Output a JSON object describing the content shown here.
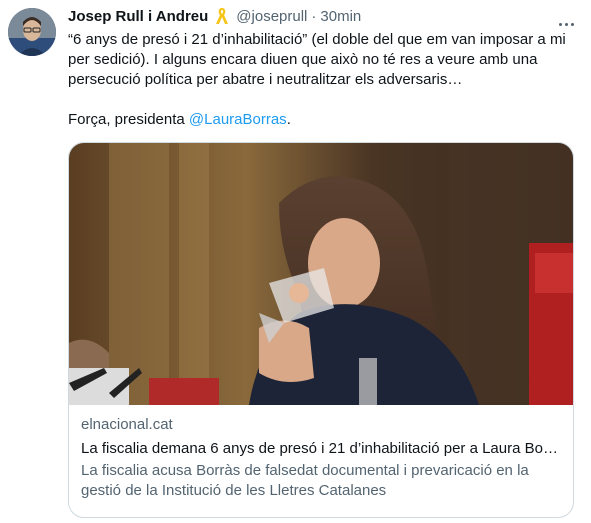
{
  "tweet": {
    "author_name": "Josep Rull i Andreu",
    "handle": "@joseprull",
    "separator": "·",
    "time": "30min",
    "text_line1": "“6 anys de presó i 21 d’inhabilitació” (el doble del que em van imposar a mi per sedició). I alguns encara diuen que això no té res a veure amb una persecució política per abatre i neutralitzar els adversaris…",
    "text_line2_prefix": "Força, presidenta ",
    "mention": "@LauraBorras",
    "text_line2_suffix": "."
  },
  "card": {
    "domain": "elnacional.cat",
    "title": "La fiscalia demana 6 anys de presó i 21 d’inhabilitació per a Laura Bor…",
    "description": "La fiscalia acusa Borràs de falsedat documental i prevaricació en la gestió de la Institució de les Lletres Catalanes"
  },
  "icons": {
    "ribbon": "yellow-ribbon-icon",
    "more": "more-options-icon"
  },
  "colors": {
    "link": "#1d9bf0",
    "secondary_text": "#536471",
    "border": "#cfd9de",
    "ribbon": "#f5c518"
  }
}
